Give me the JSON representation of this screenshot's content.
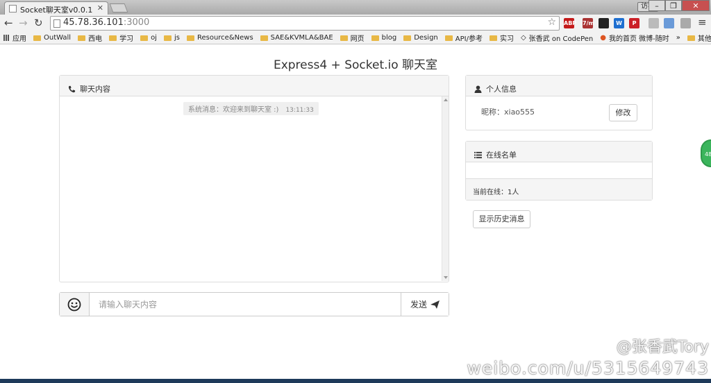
{
  "browser": {
    "tab_title": "Socket聊天室v0.0.1",
    "url_host": "45.78.36.101",
    "url_port": ":3000",
    "user_button": "访客",
    "bookmarks": [
      "应用",
      "OutWall",
      "西电",
      "学习",
      "oj",
      "js",
      "Resource&News",
      "SAE&KVMLA&BAE",
      "网页",
      "blog",
      "Design",
      "API/参考",
      "实习",
      "张香武 on CodePen",
      "我的首页 微博-随时",
      "»",
      "其他书签"
    ],
    "extensions": [
      {
        "icon": "abp-icon",
        "label": "ABP",
        "color": "#c41a1a"
      },
      {
        "icon": "counter-icon",
        "label": "7/m",
        "color": "#a33"
      },
      {
        "icon": "dot-icon",
        "label": "",
        "color": "#222"
      },
      {
        "icon": "w-icon",
        "label": "W",
        "color": "#1e6fd0"
      },
      {
        "icon": "pinterest-icon",
        "label": "P",
        "color": "#cb2027"
      },
      {
        "icon": "heart-icon",
        "label": "",
        "color": "#bbb"
      },
      {
        "icon": "puzzle-icon",
        "label": "",
        "color": "#6a9ad8"
      },
      {
        "icon": "bulb-icon",
        "label": "",
        "color": "#aaa"
      }
    ]
  },
  "page": {
    "title": "Express4 + Socket.io 聊天室"
  },
  "chat": {
    "header": "聊天内容",
    "system_message": "系统消息：欢迎来到聊天室 :)",
    "system_time": "13:11:33",
    "input_placeholder": "请输入聊天内容",
    "send_label": "发送"
  },
  "profile": {
    "header": "个人信息",
    "nickname_label": "昵称：",
    "nickname_value": "xiao555",
    "edit_label": "修改"
  },
  "online": {
    "header": "在线名单",
    "count_text": "当前在线：1人"
  },
  "history_label": "显示历史消息",
  "side_badge": "48",
  "watermark": {
    "handle": "@张香武Tory",
    "url": "weibo.com/u/5315649743"
  }
}
